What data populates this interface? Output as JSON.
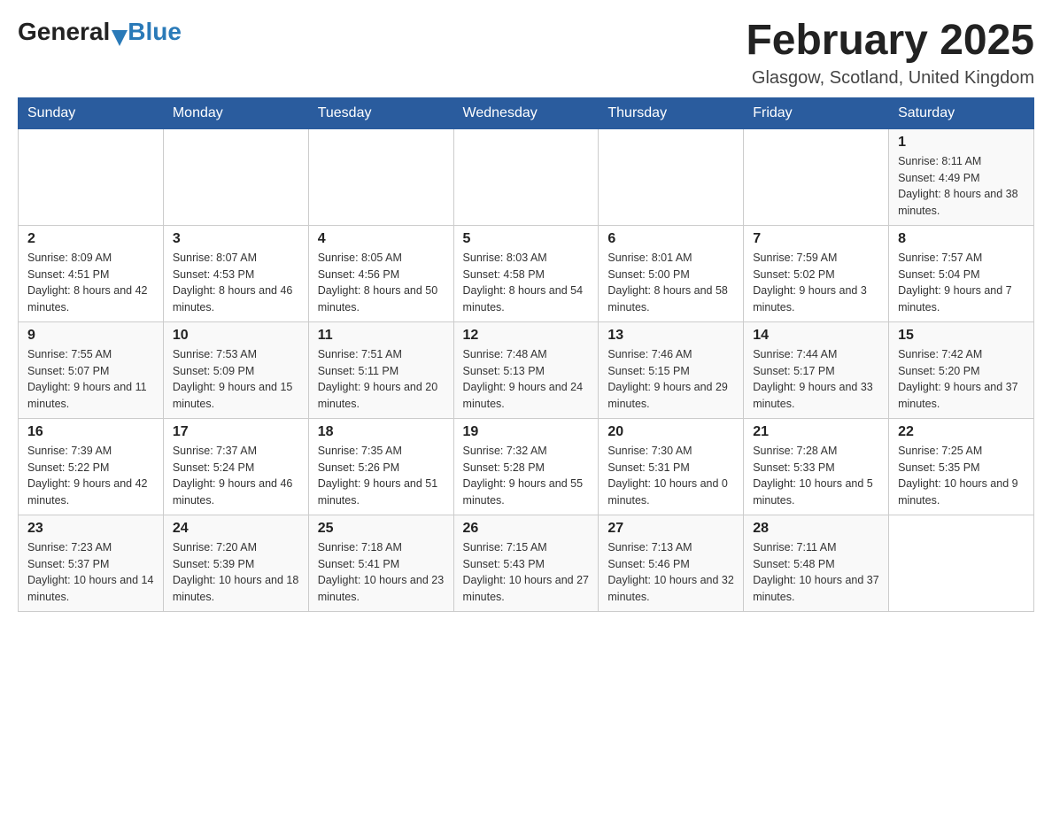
{
  "header": {
    "logo": {
      "text_general": "General",
      "arrow": "▶",
      "text_blue": "Blue"
    },
    "title": "February 2025",
    "subtitle": "Glasgow, Scotland, United Kingdom"
  },
  "days_of_week": [
    "Sunday",
    "Monday",
    "Tuesday",
    "Wednesday",
    "Thursday",
    "Friday",
    "Saturday"
  ],
  "weeks": [
    [
      {
        "day": "",
        "sunrise": "",
        "sunset": "",
        "daylight": ""
      },
      {
        "day": "",
        "sunrise": "",
        "sunset": "",
        "daylight": ""
      },
      {
        "day": "",
        "sunrise": "",
        "sunset": "",
        "daylight": ""
      },
      {
        "day": "",
        "sunrise": "",
        "sunset": "",
        "daylight": ""
      },
      {
        "day": "",
        "sunrise": "",
        "sunset": "",
        "daylight": ""
      },
      {
        "day": "",
        "sunrise": "",
        "sunset": "",
        "daylight": ""
      },
      {
        "day": "1",
        "sunrise": "Sunrise: 8:11 AM",
        "sunset": "Sunset: 4:49 PM",
        "daylight": "Daylight: 8 hours and 38 minutes."
      }
    ],
    [
      {
        "day": "2",
        "sunrise": "Sunrise: 8:09 AM",
        "sunset": "Sunset: 4:51 PM",
        "daylight": "Daylight: 8 hours and 42 minutes."
      },
      {
        "day": "3",
        "sunrise": "Sunrise: 8:07 AM",
        "sunset": "Sunset: 4:53 PM",
        "daylight": "Daylight: 8 hours and 46 minutes."
      },
      {
        "day": "4",
        "sunrise": "Sunrise: 8:05 AM",
        "sunset": "Sunset: 4:56 PM",
        "daylight": "Daylight: 8 hours and 50 minutes."
      },
      {
        "day": "5",
        "sunrise": "Sunrise: 8:03 AM",
        "sunset": "Sunset: 4:58 PM",
        "daylight": "Daylight: 8 hours and 54 minutes."
      },
      {
        "day": "6",
        "sunrise": "Sunrise: 8:01 AM",
        "sunset": "Sunset: 5:00 PM",
        "daylight": "Daylight: 8 hours and 58 minutes."
      },
      {
        "day": "7",
        "sunrise": "Sunrise: 7:59 AM",
        "sunset": "Sunset: 5:02 PM",
        "daylight": "Daylight: 9 hours and 3 minutes."
      },
      {
        "day": "8",
        "sunrise": "Sunrise: 7:57 AM",
        "sunset": "Sunset: 5:04 PM",
        "daylight": "Daylight: 9 hours and 7 minutes."
      }
    ],
    [
      {
        "day": "9",
        "sunrise": "Sunrise: 7:55 AM",
        "sunset": "Sunset: 5:07 PM",
        "daylight": "Daylight: 9 hours and 11 minutes."
      },
      {
        "day": "10",
        "sunrise": "Sunrise: 7:53 AM",
        "sunset": "Sunset: 5:09 PM",
        "daylight": "Daylight: 9 hours and 15 minutes."
      },
      {
        "day": "11",
        "sunrise": "Sunrise: 7:51 AM",
        "sunset": "Sunset: 5:11 PM",
        "daylight": "Daylight: 9 hours and 20 minutes."
      },
      {
        "day": "12",
        "sunrise": "Sunrise: 7:48 AM",
        "sunset": "Sunset: 5:13 PM",
        "daylight": "Daylight: 9 hours and 24 minutes."
      },
      {
        "day": "13",
        "sunrise": "Sunrise: 7:46 AM",
        "sunset": "Sunset: 5:15 PM",
        "daylight": "Daylight: 9 hours and 29 minutes."
      },
      {
        "day": "14",
        "sunrise": "Sunrise: 7:44 AM",
        "sunset": "Sunset: 5:17 PM",
        "daylight": "Daylight: 9 hours and 33 minutes."
      },
      {
        "day": "15",
        "sunrise": "Sunrise: 7:42 AM",
        "sunset": "Sunset: 5:20 PM",
        "daylight": "Daylight: 9 hours and 37 minutes."
      }
    ],
    [
      {
        "day": "16",
        "sunrise": "Sunrise: 7:39 AM",
        "sunset": "Sunset: 5:22 PM",
        "daylight": "Daylight: 9 hours and 42 minutes."
      },
      {
        "day": "17",
        "sunrise": "Sunrise: 7:37 AM",
        "sunset": "Sunset: 5:24 PM",
        "daylight": "Daylight: 9 hours and 46 minutes."
      },
      {
        "day": "18",
        "sunrise": "Sunrise: 7:35 AM",
        "sunset": "Sunset: 5:26 PM",
        "daylight": "Daylight: 9 hours and 51 minutes."
      },
      {
        "day": "19",
        "sunrise": "Sunrise: 7:32 AM",
        "sunset": "Sunset: 5:28 PM",
        "daylight": "Daylight: 9 hours and 55 minutes."
      },
      {
        "day": "20",
        "sunrise": "Sunrise: 7:30 AM",
        "sunset": "Sunset: 5:31 PM",
        "daylight": "Daylight: 10 hours and 0 minutes."
      },
      {
        "day": "21",
        "sunrise": "Sunrise: 7:28 AM",
        "sunset": "Sunset: 5:33 PM",
        "daylight": "Daylight: 10 hours and 5 minutes."
      },
      {
        "day": "22",
        "sunrise": "Sunrise: 7:25 AM",
        "sunset": "Sunset: 5:35 PM",
        "daylight": "Daylight: 10 hours and 9 minutes."
      }
    ],
    [
      {
        "day": "23",
        "sunrise": "Sunrise: 7:23 AM",
        "sunset": "Sunset: 5:37 PM",
        "daylight": "Daylight: 10 hours and 14 minutes."
      },
      {
        "day": "24",
        "sunrise": "Sunrise: 7:20 AM",
        "sunset": "Sunset: 5:39 PM",
        "daylight": "Daylight: 10 hours and 18 minutes."
      },
      {
        "day": "25",
        "sunrise": "Sunrise: 7:18 AM",
        "sunset": "Sunset: 5:41 PM",
        "daylight": "Daylight: 10 hours and 23 minutes."
      },
      {
        "day": "26",
        "sunrise": "Sunrise: 7:15 AM",
        "sunset": "Sunset: 5:43 PM",
        "daylight": "Daylight: 10 hours and 27 minutes."
      },
      {
        "day": "27",
        "sunrise": "Sunrise: 7:13 AM",
        "sunset": "Sunset: 5:46 PM",
        "daylight": "Daylight: 10 hours and 32 minutes."
      },
      {
        "day": "28",
        "sunrise": "Sunrise: 7:11 AM",
        "sunset": "Sunset: 5:48 PM",
        "daylight": "Daylight: 10 hours and 37 minutes."
      },
      {
        "day": "",
        "sunrise": "",
        "sunset": "",
        "daylight": ""
      }
    ]
  ]
}
